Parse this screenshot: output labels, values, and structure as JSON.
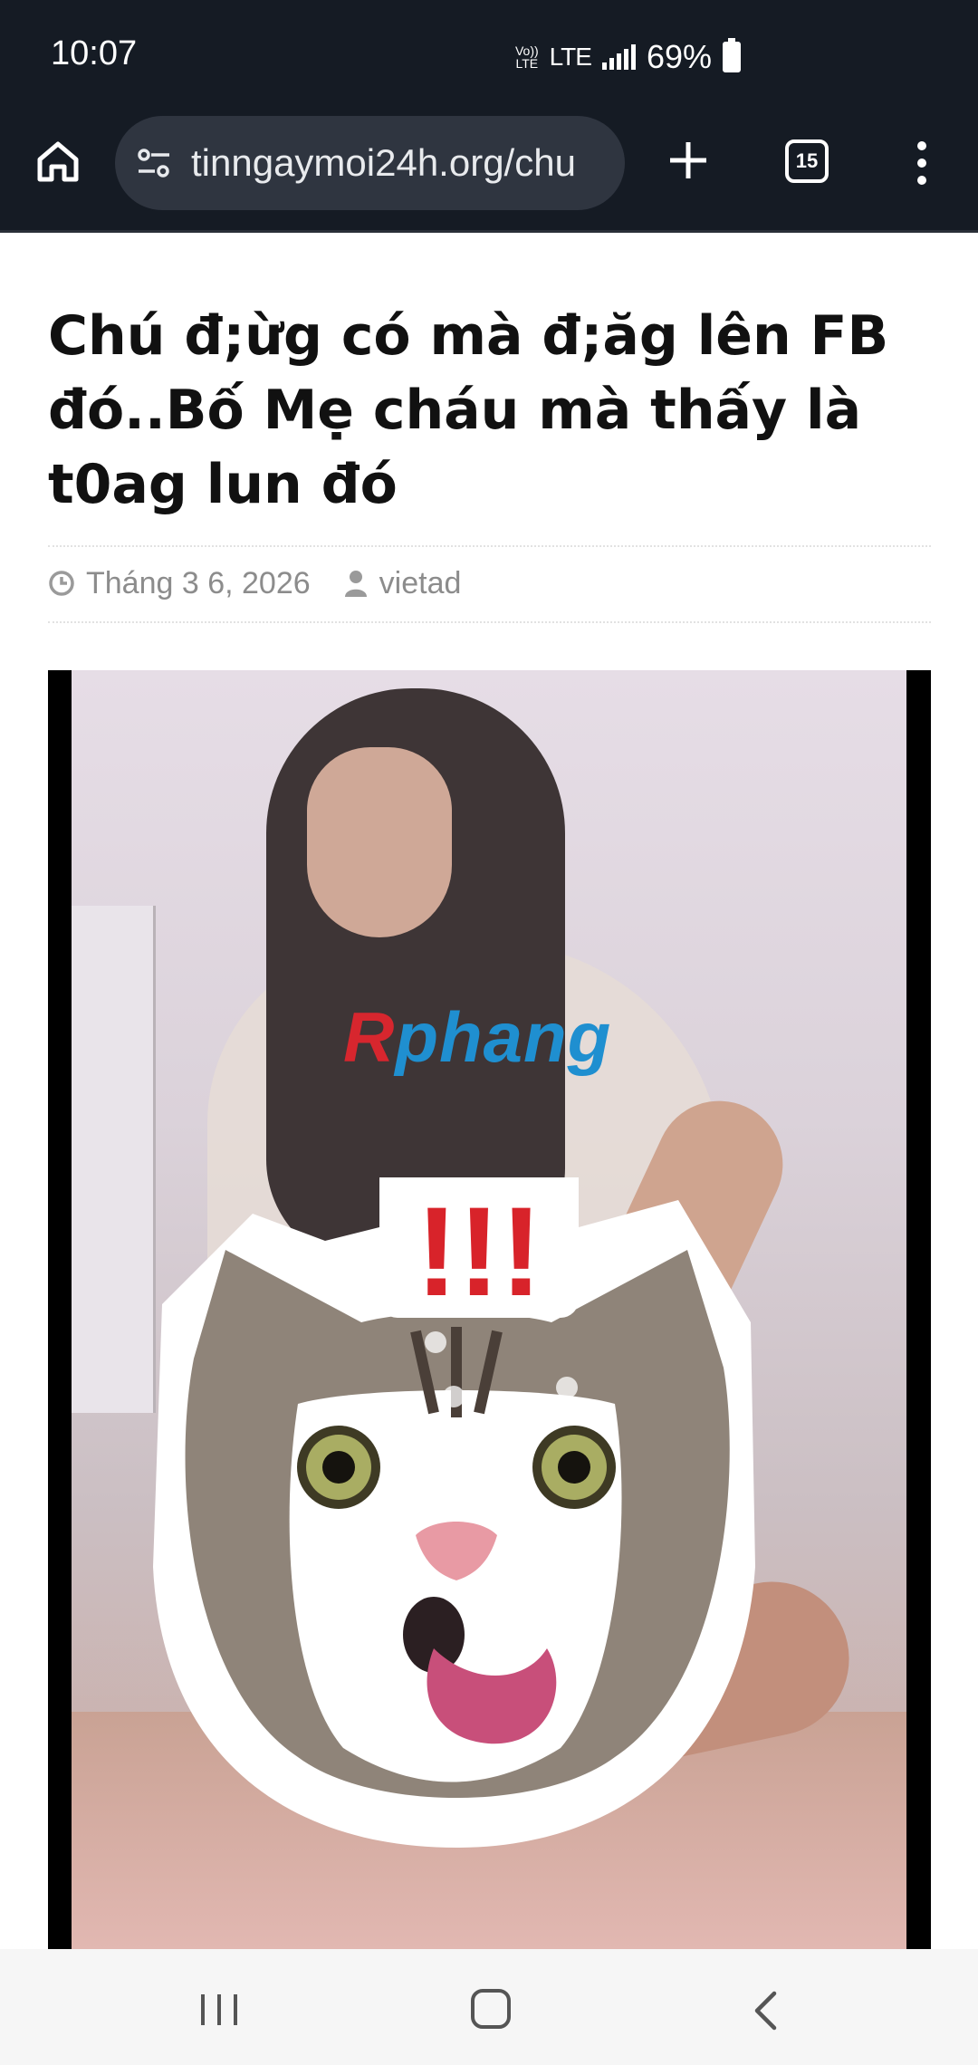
{
  "status_bar": {
    "time": "10:07",
    "volte": "Vo)) LTE",
    "network": "LTE",
    "battery_percent": "69%",
    "signal_icon": "signal-bars-icon",
    "battery_icon": "battery-icon"
  },
  "browser": {
    "url": "tinngaymoi24h.org/chu",
    "tab_count": "15",
    "icons": [
      "home-icon",
      "site-settings-icon",
      "plus-icon",
      "tab-switcher-icon",
      "more-vert-icon"
    ]
  },
  "article": {
    "title": "Chú đ;ừg có mà đ;ăg lên FB đó..Bố Mẹ cháu mà thấy là t0ag lun đó",
    "date": "Tháng 3 6, 2026",
    "author": "vietad",
    "media": {
      "watermark_part1": "R",
      "watermark_part2": "phang",
      "sticker_text": "!!!"
    }
  },
  "colors": {
    "chrome_bg": "#151b24",
    "url_bg": "#2f3540",
    "title": "#111111",
    "meta": "#8c8c8c",
    "watermark_red": "#d7262e",
    "watermark_blue": "#1f8fd0"
  },
  "nav_bar": {
    "icons": [
      "recent-apps-icon",
      "home-nav-icon",
      "back-icon"
    ]
  }
}
